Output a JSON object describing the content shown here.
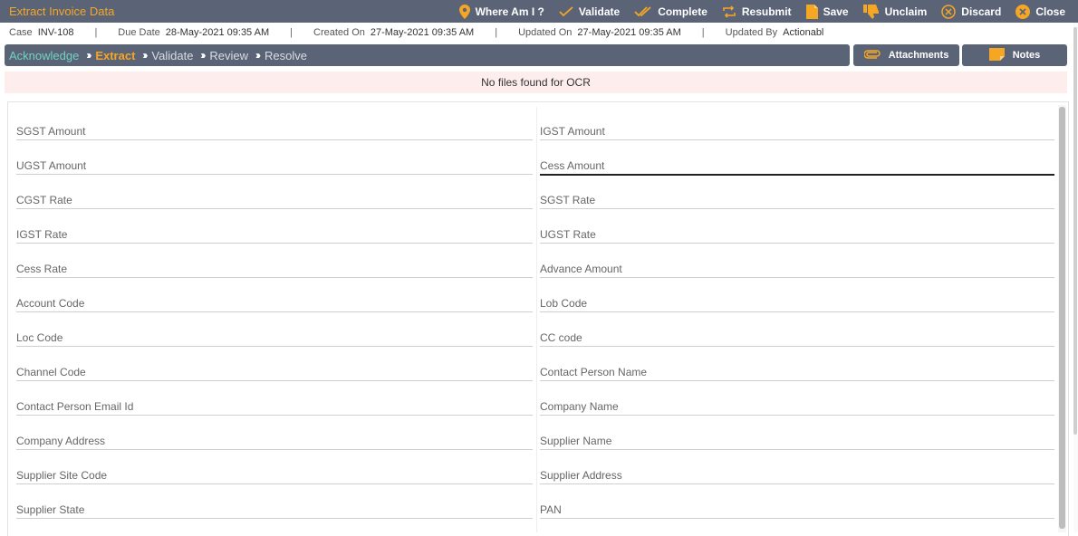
{
  "app": {
    "title": "Extract Invoice Data"
  },
  "toolbar": {
    "where": "Where Am I ?",
    "validate": "Validate",
    "complete": "Complete",
    "resubmit": "Resubmit",
    "save": "Save",
    "unclaim": "Unclaim",
    "discard": "Discard",
    "close": "Close"
  },
  "meta": {
    "case_label": "Case",
    "case_value": "INV-108",
    "due_label": "Due Date",
    "due_value": "28-May-2021 09:35 AM",
    "created_label": "Created On",
    "created_value": "27-May-2021 09:35 AM",
    "updated_label": "Updated On",
    "updated_value": "27-May-2021 09:35 AM",
    "updatedby_label": "Updated By",
    "updatedby_value": "Actionabl",
    "separator": "|"
  },
  "stages": [
    {
      "label": "Acknowledge",
      "state": "done"
    },
    {
      "label": "Extract",
      "state": "active"
    },
    {
      "label": "Validate",
      "state": "pending"
    },
    {
      "label": "Review",
      "state": "pending"
    },
    {
      "label": "Resolve",
      "state": "pending"
    }
  ],
  "stage_separator": "›››",
  "side_buttons": {
    "attachments": "Attachments",
    "notes": "Notes"
  },
  "ocr_message": "No files found for OCR",
  "fields": [
    {
      "label": "SGST Amount",
      "value": ""
    },
    {
      "label": "IGST Amount",
      "value": ""
    },
    {
      "label": "UGST Amount",
      "value": ""
    },
    {
      "label": "Cess Amount",
      "value": "",
      "focused": true
    },
    {
      "label": "CGST Rate",
      "value": ""
    },
    {
      "label": "SGST Rate",
      "value": ""
    },
    {
      "label": "IGST Rate",
      "value": ""
    },
    {
      "label": "UGST Rate",
      "value": ""
    },
    {
      "label": "Cess Rate",
      "value": ""
    },
    {
      "label": "Advance Amount",
      "value": ""
    },
    {
      "label": "Account Code",
      "value": ""
    },
    {
      "label": "Lob Code",
      "value": ""
    },
    {
      "label": "Loc Code",
      "value": ""
    },
    {
      "label": "CC code",
      "value": ""
    },
    {
      "label": "Channel Code",
      "value": ""
    },
    {
      "label": "Contact Person Name",
      "value": ""
    },
    {
      "label": "Contact Person Email Id",
      "value": ""
    },
    {
      "label": "Company Name",
      "value": ""
    },
    {
      "label": "Company Address",
      "value": ""
    },
    {
      "label": "Supplier Name",
      "value": ""
    },
    {
      "label": "Supplier Site Code",
      "value": ""
    },
    {
      "label": "Supplier Address",
      "value": ""
    },
    {
      "label": "Supplier State",
      "value": ""
    },
    {
      "label": "PAN",
      "value": ""
    }
  ],
  "colors": {
    "bar": "#5b6477",
    "accent": "#f5a623",
    "done": "#6fd3c2",
    "ocr_bg": "#fdeeed"
  }
}
